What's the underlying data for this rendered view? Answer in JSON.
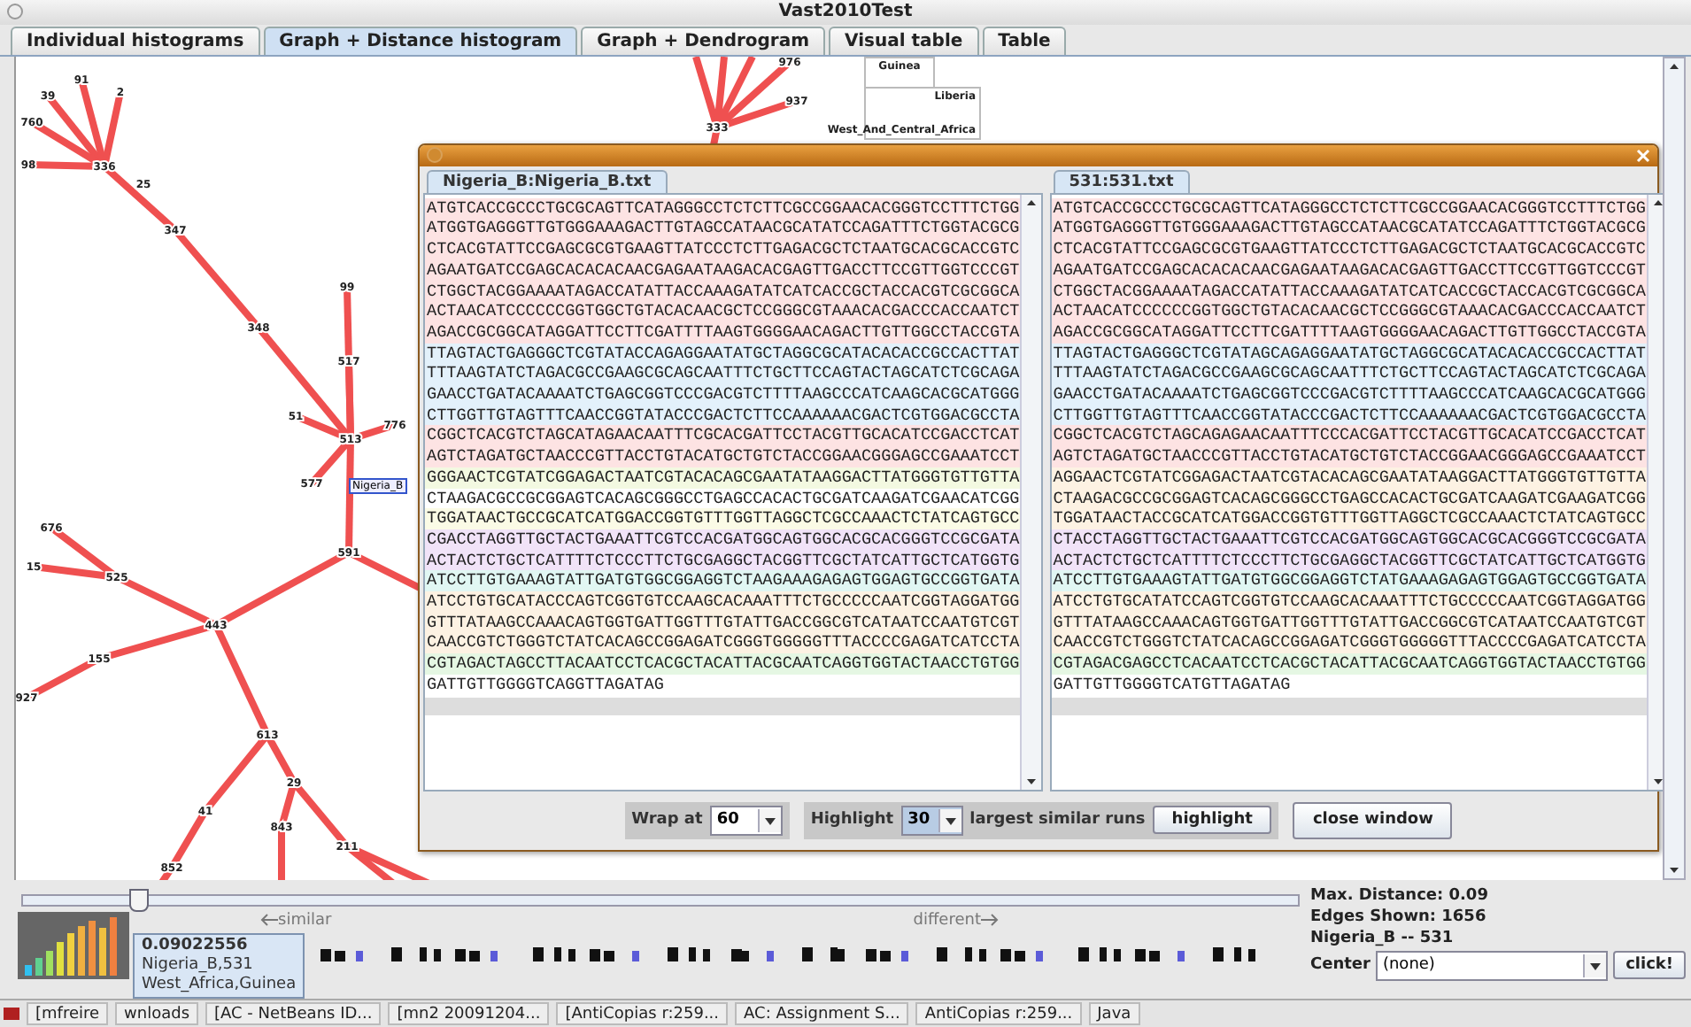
{
  "window": {
    "title": "Vast2010Test"
  },
  "tabs": [
    {
      "label": "Individual histograms",
      "selected": false
    },
    {
      "label": "Graph + Distance histogram",
      "selected": true
    },
    {
      "label": "Graph + Dendrogram",
      "selected": false
    },
    {
      "label": "Visual table",
      "selected": false
    },
    {
      "label": "Table",
      "selected": false
    }
  ],
  "graph": {
    "node_labels": [
      "39",
      "91",
      "2",
      "760",
      "98",
      "336",
      "25",
      "347",
      "348",
      "99",
      "517",
      "51",
      "513",
      "776",
      "577",
      "591",
      "676",
      "15",
      "525",
      "443",
      "155",
      "927",
      "613",
      "41",
      "29",
      "843",
      "211",
      "852",
      "976",
      "937",
      "333"
    ],
    "selected_label": "Nigeria_B",
    "region_boxes": [
      {
        "labels": [
          "Guinea"
        ]
      },
      {
        "labels": [
          "Liberia",
          "West_And_Central_Africa"
        ]
      }
    ]
  },
  "dialog": {
    "panels": [
      {
        "tab": "Nigeria_B:Nigeria_B.txt",
        "lines": [
          {
            "text": "ATGTCACCGCCCTGCGCAGTTCATAGGGCCTCTCTTCGCCGGAACACGGGTCCTTTCTGG",
            "color": "#fde3e3"
          },
          {
            "text": "ATGGTGAGGGTTGTGGGAAAGACTTGTAGCCATAACGCATATCCAGATTTCTGGTACGCG",
            "color": "#fde3e3"
          },
          {
            "text": "CTCACGTATTCCGAGCGCGTGAAGTTATCCCTCTTGAGACGCTCTAATGCACGCACCGTC",
            "color": "#fde3e3"
          },
          {
            "text": "AGAATGATCCGAGCACACACAACGAGAATAAGACACGAGTTGACCTTCCGTTGGTCCCGT",
            "color": "#fde3e3"
          },
          {
            "text": "CTGGCTACGGAAAATAGACCATATTACCAAAGATATCATCACCGCTACCACGTCGCGGCA",
            "color": "#fde3e3"
          },
          {
            "text": "ACTAACATCCCCCCGGTGGCTGTACACAACGCTCCGGGCGTAAACACGACCCACCAATCT",
            "color": "#fde3e3"
          },
          {
            "text": "AGACCGCGGCATAGGATTCCTTCGATTTTAAGTGGGGAACAGACTTGTTGGCCTACCGTA",
            "color": "#fde3e3"
          },
          {
            "text": "TTAGTACTGAGGGCTCGTATACCAGAGGAATATGCTAGGCGCATACACACCGCCACTTAT",
            "color": "#e3f1fb"
          },
          {
            "text": "TTTAAGTATCTAGACGCCGAAGCGCAGCAATTTCTGCTTCCAGTACTAGCATCTCGCAGA",
            "color": "#e3f1fb"
          },
          {
            "text": "GAACCTGATACAAAATCTGAGCGGTCCCGACGTCTTTTAAGCCCATCAAGCACGCATGGG",
            "color": "#e3f1fb"
          },
          {
            "text": "CTTGGTTGTAGTTTCAACCGGTATACCCGACTCTTCCAAAAAACGACTCGTGGACGCCTA",
            "color": "#e3f1fb"
          },
          {
            "text": "CGGCTCACGTCTAGCATAGAACAATTTCGCACGATTCCTACGTTGCACATCCGACCTCAT",
            "color": "#fde3e3"
          },
          {
            "text": "AGTCTAGATGCTAACCCGTTACCTGTACATGCTGTCTACCGGAACGGGAGCCGAAATCCT",
            "color": "#fde3e3"
          },
          {
            "text": "GGGAACTCGTATCGGAGACTAATCGTACACAGCGAATATAAGGACTTATGGGTGTTGTTA",
            "color": "#f3f9e1"
          },
          {
            "text": "CTAAGACGCCGCGGAGTCACAGCGGGCCTGAGCCACACTGCGATCAAGATCGAACATCGG",
            "color": "#ffffff"
          },
          {
            "text": "TGGATAACTGCCGCATCATGGACCGGTGTTTGGTTAGGCTCGCCAAACTCTATCAGTGCC",
            "color": "#fbfbe6"
          },
          {
            "text": "CGACCTAGGTTGCTACTGAAATTCGTCCACGATGGCAGTGGCACGCACGGGTCCGCGATA",
            "color": "#f1e3f8"
          },
          {
            "text": "ACTACTCTGCTCATTTTCTCCCTTCTGCGAGGCTACGGTTCGCTATCATTGCTCATGGTG",
            "color": "#f1e3f8"
          },
          {
            "text": "ATCCTTGTGAAAGTATTGATGTGGCGGAGGTCTAAGAAAGAGAGTGGAGTGCCGGTGATA",
            "color": "#e1f7f3"
          },
          {
            "text": "ATCCTGTGCATACCCAGTCGGTGTCCAAGCACAAATTTCTGCCCCCAATCGGTAGGATGG",
            "color": "#fdf2e3"
          },
          {
            "text": "GTTTATAAGCCAAACAGTGGTGATTGGTTTGTATTGACCGGCGTCATAATCCAATGTCGT",
            "color": "#fdf2e3"
          },
          {
            "text": "CAACCGTCTGGGTCTATCACAGCCGGAGATCGGGTGGGGGTTTACCCCGAGATCATCCTA",
            "color": "#fdf2e3"
          },
          {
            "text": "CGTAGACTAGCCTTACAATCCTCACGCTACATTACGCAATCAGGTGGTACTAACCTGTGG",
            "color": "#e5f7e3"
          },
          {
            "text": "GATTGTTGGGGTCAGGTTAGATAG",
            "color": "#ffffff"
          }
        ]
      },
      {
        "tab": "531:531.txt",
        "lines": [
          {
            "text": "ATGTCACCGCCCTGCGCAGTTCATAGGGCCTCTCTTCGCCGGAACACGGGTCCTTTCTGG",
            "color": "#fde3e3"
          },
          {
            "text": "ATGGTGAGGGTTGTGGGAAAGACTTGTAGCCATAACGCATATCCAGATTTCTGGTACGCG",
            "color": "#fde3e3"
          },
          {
            "text": "CTCACGTATTCCGAGCGCGTGAAGTTATCCCTCTTGAGACGCTCTAATGCACGCACCGTC",
            "color": "#fde3e3"
          },
          {
            "text": "AGAATGATCCGAGCACACACAACGAGAATAAGACACGAGTTGACCTTCCGTTGGTCCCGT",
            "color": "#fde3e3"
          },
          {
            "text": "CTGGCTACGGAAAATAGACCATATTACCAAAGATATCATCACCGCTACCACGTCGCGGCA",
            "color": "#fde3e3"
          },
          {
            "text": "ACTAACATCCCCCCGGTGGCTGTACACAACGCTCCGGGCGTAAACACGACCCACCAATCT",
            "color": "#fde3e3"
          },
          {
            "text": "AGACCGCGGCATAGGATTCCTTCGATTTTAAGTGGGGAACAGACTTGTTGGCCTACCGTA",
            "color": "#fde3e3"
          },
          {
            "text": "TTAGTACTGAGGGCTCGTATAGCAGAGGAATATGCTAGGCGCATACACACCGCCACTTAT",
            "color": "#e3f1fb"
          },
          {
            "text": "TTTAAGTATCTAGACGCCGAAGCGCAGCAATTTCTGCTTCCAGTACTAGCATCTCGCAGA",
            "color": "#e3f1fb"
          },
          {
            "text": "GAACCTGATACAAAATCTGAGCGGTCCCGACGTCTTTTAAGCCCATCAAGCACGCATGGG",
            "color": "#e3f1fb"
          },
          {
            "text": "CTTGGTTGTAGTTTCAACCGGTATACCCGACTCTTCCAAAAAACGACTCGTGGACGCCTA",
            "color": "#e3f1fb"
          },
          {
            "text": "CGGCTCACGTCTAGCAGAGAACAATTTCCCACGATTCCTACGTTGCACATCCGACCTCAT",
            "color": "#fde3e3"
          },
          {
            "text": "AGTCTAGATGCTAACCCGTTACCTGTACATGCTGTCTACCGGAACGGGAGCCGAAATCCT",
            "color": "#fde3e3"
          },
          {
            "text": "AGGAACTCGTATCGGAGACTAATCGTACACAGCGAATATAAGGACTTATGGGTGTTGTTA",
            "color": "#fdf2e3"
          },
          {
            "text": "CTAAGACGCCGCGGAGTCACAGCGGGCCTGAGCCACACTGCGATCAAGATCGAAGATCGG",
            "color": "#fdf2e3"
          },
          {
            "text": "TGGATAACTACCGCATCATGGACCGGTGTTTGGTTAGGCTCGCCAAACTCTATCAGTGCC",
            "color": "#fdf2e3"
          },
          {
            "text": "CTACCTAGGTTGCTACTGAAATTCGTCCACGATGGCAGTGGCACGCACGGGTCCGCGATA",
            "color": "#f1e3f8"
          },
          {
            "text": "ACTACTCTGCTCATTTTCTCCCTTCTGCGAGGCTACGGTTCGCTATCATTGCTCATGGTG",
            "color": "#f1e3f8"
          },
          {
            "text": "ATCCTTGTGAAAGTATTGATGTGGCGGAGGTCTATGAAAGAGAGTGGAGTGCCGGTGATA",
            "color": "#e1f7f3"
          },
          {
            "text": "ATCCTGTGCATATCCAGTCGGTGTCCAAGCACAAATTTCTGCCCCCAATCGGTAGGATGG",
            "color": "#fdf2e3"
          },
          {
            "text": "GTTTATAAGCCAAACAGTGGTGATTGGTTTGTATTGACCGGCGTCATAATCCAATGTCGT",
            "color": "#fdf2e3"
          },
          {
            "text": "CAACCGTCTGGGTCTATCACAGCCGGAGATCGGGTGGGGGTTTACCCCGAGATCATCCTA",
            "color": "#fdf2e3"
          },
          {
            "text": "CGTAGACGAGCCTCACAATCCTCACGCTACATTACGCAATCAGGTGGTACTAACCTGTGG",
            "color": "#e5f7e3"
          },
          {
            "text": "GATTGTTGGGGTCATGTTAGATAG",
            "color": "#ffffff"
          }
        ]
      }
    ],
    "wrap": {
      "label": "Wrap at",
      "value": "60"
    },
    "highlight": {
      "label": "Highlight",
      "value": "30",
      "suffix": "largest similar runs",
      "button": "highlight"
    },
    "close_button": "close window"
  },
  "distance": {
    "level": 0.09,
    "similar_label": "similar",
    "different_label": "different",
    "info": [
      "Max. Distance: 0.09",
      "Edges Shown: 1656",
      "Nigeria_B -- 531"
    ],
    "center": {
      "label": "Center",
      "value": "(none)"
    },
    "click_button": "click!",
    "tooltip": [
      "0.09022556",
      "Nigeria_B,531",
      "West_Africa,Guinea"
    ]
  },
  "taskbar": {
    "items": [
      {
        "label": "[mfreire"
      },
      {
        "label": "wnloads"
      },
      {
        "label": "[AC - NetBeans ID..."
      },
      {
        "label": "[mn2 20091204..."
      },
      {
        "label": "[AntiCopias r:259..."
      },
      {
        "label": "AC: Assignment S..."
      },
      {
        "label": "AntiCopias r:259..."
      },
      {
        "label": "Java"
      }
    ]
  }
}
